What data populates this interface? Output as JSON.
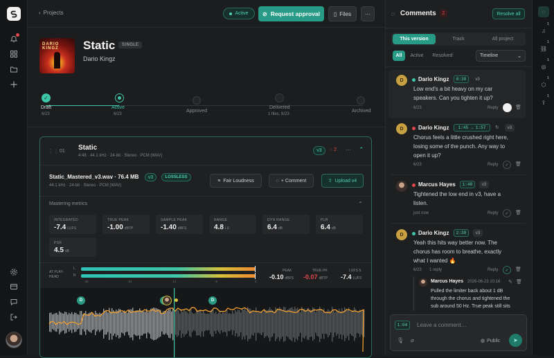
{
  "topbar": {
    "back_label": "Projects",
    "status_label": "Active",
    "request_label": "Request approval",
    "files_label": "Files",
    "more_label": "···"
  },
  "release": {
    "title": "Static",
    "type_badge": "SINGLE",
    "artist": "Dario Kingz",
    "cover_text": "DARIO KINGZ"
  },
  "steps": [
    {
      "label": "Draft",
      "date": "6/23"
    },
    {
      "label": "Active",
      "date": "6/23"
    },
    {
      "label": "Approved",
      "date": ""
    },
    {
      "label": "Delivered",
      "date": "1 files, 6/23"
    },
    {
      "label": "Archived",
      "date": ""
    }
  ],
  "track": {
    "number": "01",
    "title": "Static",
    "meta": "4:48 · 44.1 kHz · 24-bit · Stereo · PCM (WAV)",
    "version_badge": "v3",
    "comment_count": "2"
  },
  "file": {
    "name": "Static_Mastered_v3.wav · 76.4 MB",
    "version": "v3",
    "lossless": "LOSSLESS",
    "meta": "44.1 kHz · 24-bit · Stereo · PCM (WAV)",
    "fair_loudness": "Fair Loudness",
    "comment_btn": "+ Comment",
    "upload_btn": "Upload v4"
  },
  "metrics_title": "Mastering metrics",
  "metrics": [
    {
      "label": "INTEGRATED",
      "value": "-7.4",
      "unit": "LUFS"
    },
    {
      "label": "TRUE PEAK",
      "value": "-1.00",
      "unit": "dBTP"
    },
    {
      "label": "SAMPLE PEAK",
      "value": "-1.40",
      "unit": "dBFS"
    },
    {
      "label": "RANGE",
      "value": "4.8",
      "unit": "LU"
    },
    {
      "label": "DYN RANGE",
      "value": "6.4",
      "unit": "dB"
    },
    {
      "label": "PLR",
      "value": "6.4",
      "unit": "dB"
    },
    {
      "label": "PSR",
      "value": "4.5",
      "unit": "dB"
    }
  ],
  "meter": {
    "label": "AT PLAY-HEAD",
    "ch_l": "L",
    "ch_r": "R",
    "scale": [
      "-48",
      "-24",
      "-12",
      "-6",
      "0"
    ],
    "peak_label": "PEAK",
    "peak_value": "-0.10",
    "peak_unit": "dBFS",
    "tp_label": "TRUE PK",
    "tp_value": "-0.07",
    "tp_unit": "dBTP",
    "lufs_label": "LUFS S",
    "lufs_value": "-7.4",
    "lufs_unit": "LUFS"
  },
  "markers": [
    "D",
    "D",
    "D"
  ],
  "comments_panel": {
    "title": "Comments",
    "count": "2",
    "resolve_all": "Resolve all",
    "scope_tabs": [
      "This version",
      "Track",
      "All project"
    ],
    "filter_tabs": [
      "All",
      "Active",
      "Resolved"
    ],
    "sort": "Timeline",
    "input_time": "1:04",
    "input_placeholder": "Leave a comment…",
    "visibility": "Public"
  },
  "comments": [
    {
      "author": "Dario Kingz",
      "time": "0:30",
      "version": "v3",
      "text1": "Low end's a bit heavy on my car",
      "text2": "speakers. Can you tighten it up?",
      "date": "6/23",
      "reply": "Reply"
    },
    {
      "author": "Dario Kingz",
      "time": "1:45 → 1:57",
      "version": "v3",
      "text1": "Chorus feels a little crushed right here,",
      "text2": "losing some of the punch. Any way to",
      "text3": "open it up?",
      "date": "6/23",
      "reply": "Reply"
    },
    {
      "author": "Marcus Hayes",
      "time": "1:48",
      "version": "v3",
      "text1": "Tightened the low end in v3, have a",
      "text2": "listen.",
      "date": "just now",
      "reply": "Reply"
    },
    {
      "author": "Dario Kingz",
      "time": "2:30",
      "version": "v3",
      "text1": "Yeah this hits way better now. The",
      "text2": "chorus has room to breathe, exactly",
      "text3": "what I wanted 🔥",
      "date": "6/23",
      "replies": "1 reply",
      "reply": "Reply"
    }
  ],
  "nested_reply": {
    "author": "Marcus Hayes",
    "date": "2026-06-23 10:16",
    "text1": "Pulled the limiter back about 1 dB",
    "text2": "through the chorus and tightened the",
    "text3": "sub around 50 Hz. True peak still sits"
  },
  "rail_badges": [
    "1",
    "1",
    "1",
    "1",
    "1"
  ],
  "colors": {
    "accent": "#3ec7a9",
    "accent_dark": "#1f7a69",
    "danger": "#e5484d",
    "warn": "#f0a030"
  }
}
